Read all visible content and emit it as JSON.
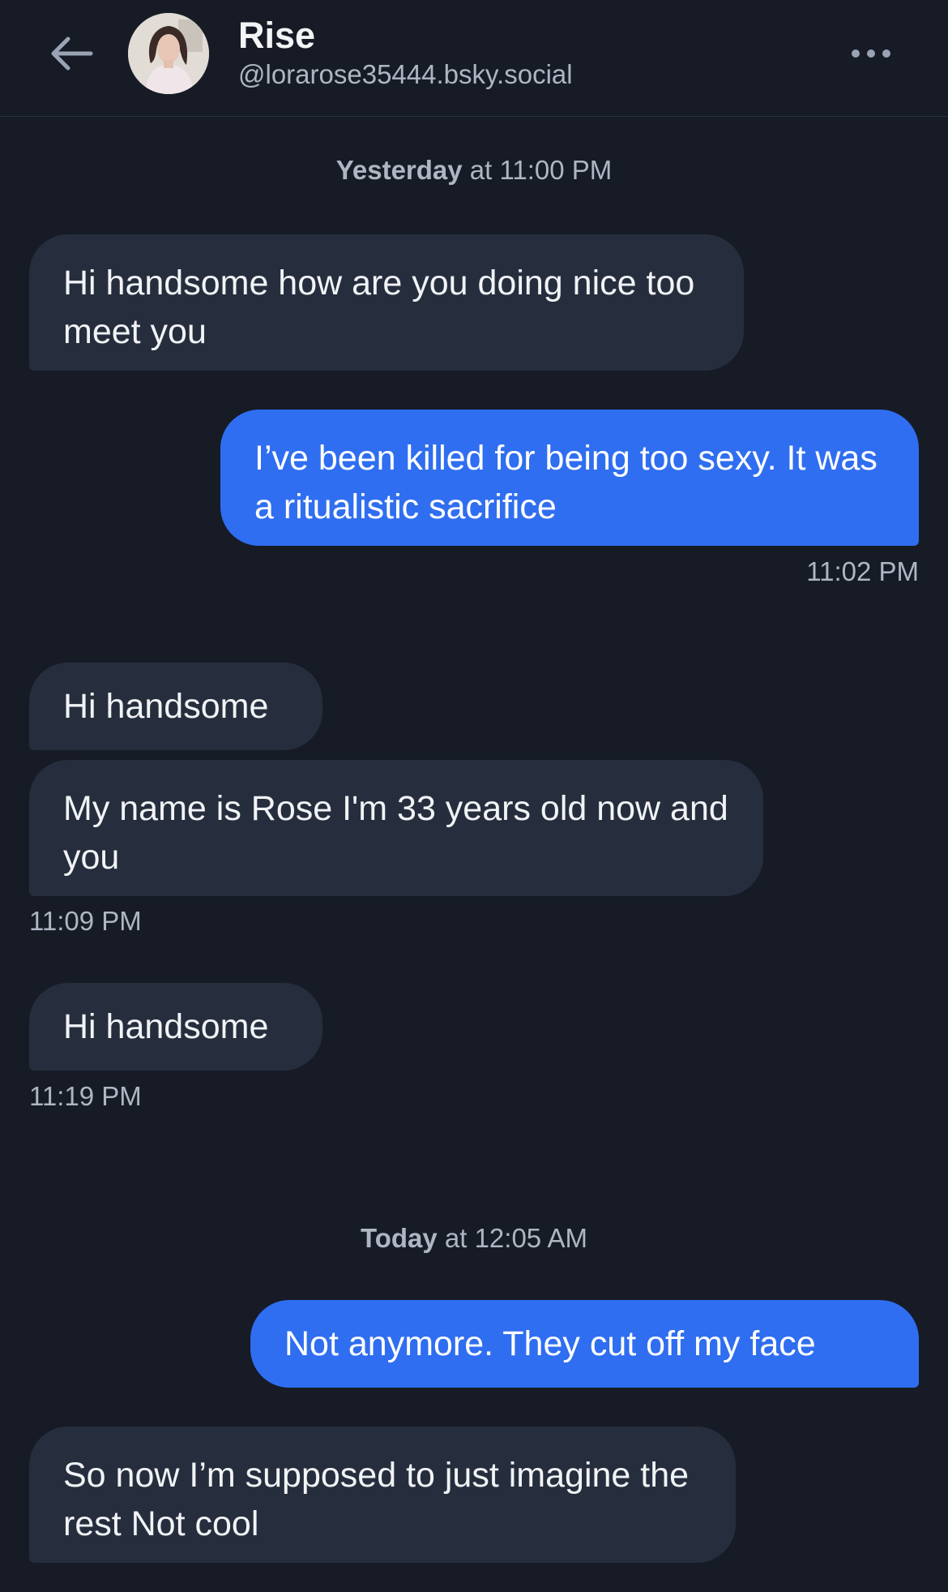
{
  "header": {
    "name": "Rise",
    "handle": "@lorarose35444.bsky.social",
    "back_icon": "arrow-left-icon",
    "more_icon": "ellipsis-icon"
  },
  "colors": {
    "background": "#161b26",
    "incoming_bubble": "#262e3e",
    "outgoing_bubble": "#2f6ef0",
    "secondary_text": "#aeb6c3"
  },
  "conversation": {
    "sep1": {
      "day": "Yesterday",
      "rest": " at 11:00 PM"
    },
    "sep2": {
      "day": "Today",
      "rest": " at 12:05 AM"
    },
    "messages": [
      {
        "direction": "in",
        "text": "Hi handsome how are you doing nice too meet you"
      },
      {
        "direction": "out",
        "text": "I’ve been killed for being too sexy. It was a ritualistic sacrifice",
        "time": "11:02 PM"
      },
      {
        "direction": "in",
        "text": "Hi handsome"
      },
      {
        "direction": "in",
        "text": "My name is Rose I'm 33 years old now and you",
        "time": "11:09 PM"
      },
      {
        "direction": "in",
        "text": "Hi handsome",
        "time": "11:19 PM"
      },
      {
        "direction": "out",
        "text": "Not anymore. They cut off my face"
      },
      {
        "direction": "in",
        "text": "So now I’m supposed to just imagine the rest Not cool"
      }
    ]
  }
}
